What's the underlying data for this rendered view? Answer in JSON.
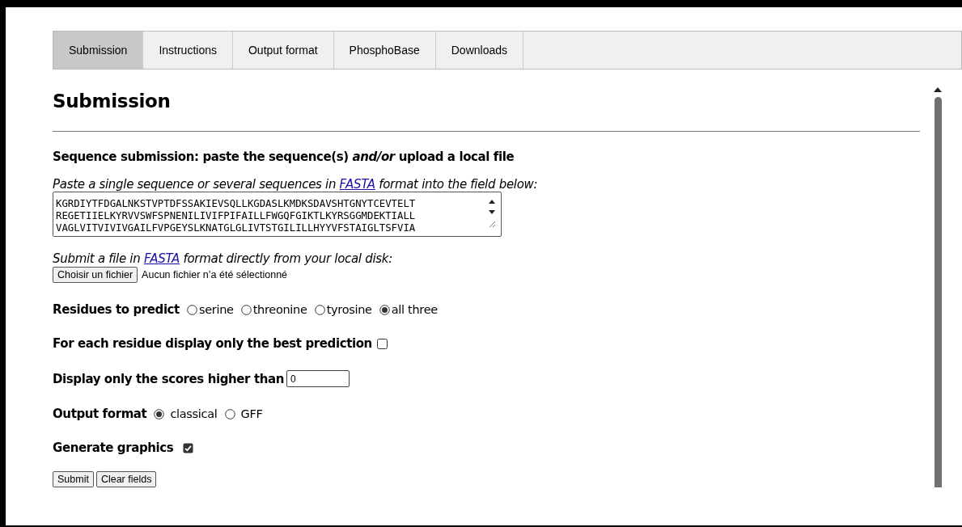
{
  "tabs": [
    {
      "label": "Submission",
      "selected": true
    },
    {
      "label": "Instructions",
      "selected": false
    },
    {
      "label": "Output format",
      "selected": false
    },
    {
      "label": "PhosphoBase",
      "selected": false
    },
    {
      "label": "Downloads",
      "selected": false
    }
  ],
  "heading": "Submission",
  "sequence_section": {
    "title": "Sequence submission: paste the sequence(s) *and/or* upload a local file",
    "paste_hint": {
      "before": "Paste a single sequence or several sequences in ",
      "link": "FASTA",
      "after": " format into the field below:"
    },
    "sequence_lines": [
      "KGRDIYTFDGALNKSTVPTDFSSAKIEVSQLLKGDASLKMDKSDAVSHTGNYTCEVTELT",
      "REGETIIELKYRVVSWFSPNENILIVIFPIFAILLFWGQFGIKTLKYRSGGMDEKTIALL",
      "VAGLVITVIVIVGAILFVPGEYSLKNATGLGLIVTSTGILILLHYYVFSTAIGLTSFVIA"
    ],
    "file_hint": {
      "before": "Submit a file in ",
      "link": "FASTA",
      "after": " format directly from your local disk:"
    },
    "file_button": "Choisir un fichier",
    "file_status": "Aucun fichier n’a été sélectionné"
  },
  "residues": {
    "label": "Residues to predict",
    "options": [
      {
        "label": "serine",
        "selected": false
      },
      {
        "label": "threonine",
        "selected": false
      },
      {
        "label": "tyrosine",
        "selected": false
      },
      {
        "label": "all three",
        "selected": true
      }
    ]
  },
  "best_prediction": {
    "label": "For each residue display only the best prediction",
    "checked": false
  },
  "threshold": {
    "label": "Display only the scores higher than",
    "value": "0"
  },
  "output_format": {
    "label": "Output format",
    "options": [
      {
        "label": "classical",
        "selected": true
      },
      {
        "label": "GFF",
        "selected": false
      }
    ]
  },
  "graphics": {
    "label": "Generate graphics",
    "checked": true
  },
  "buttons": [
    "Submit",
    "Clear fields"
  ]
}
